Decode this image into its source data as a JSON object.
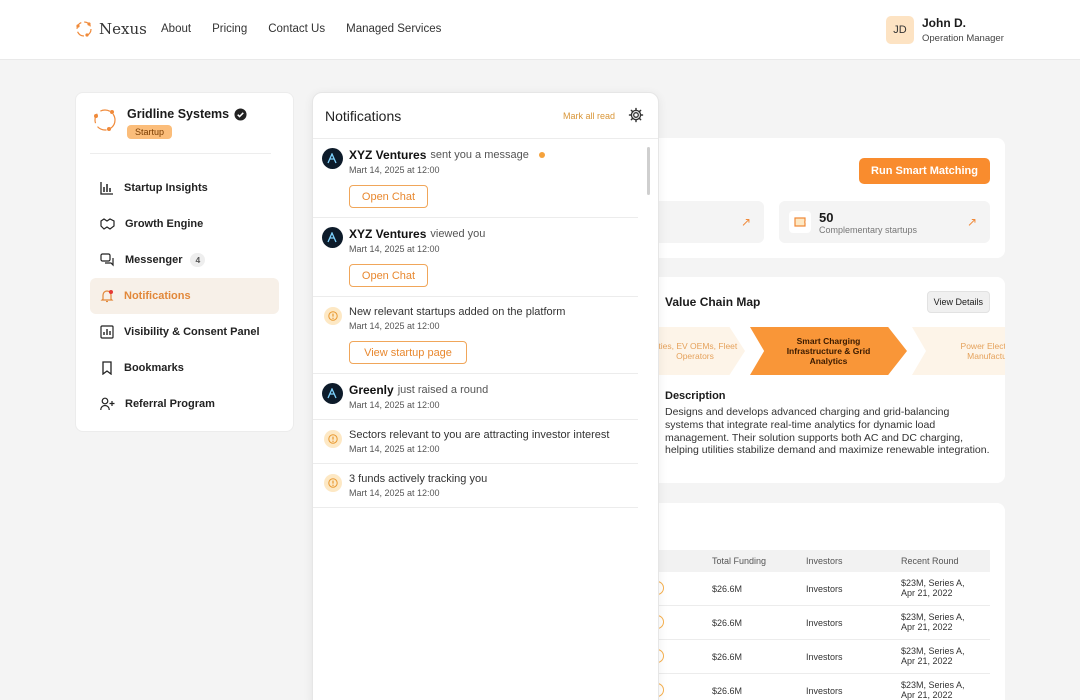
{
  "brand": {
    "name": "Nexus"
  },
  "nav": [
    "About",
    "Pricing",
    "Contact Us",
    "Managed Services"
  ],
  "user": {
    "initials": "JD",
    "name": "John D.",
    "role": "Operation Manager"
  },
  "company": {
    "name": "Gridline Systems",
    "badge": "Startup"
  },
  "menu": [
    {
      "label": "Startup Insights"
    },
    {
      "label": "Growth Engine"
    },
    {
      "label": "Messenger",
      "count": "4"
    },
    {
      "label": "Notifications"
    },
    {
      "label": "Visibility & Consent Panel"
    },
    {
      "label": "Bookmarks"
    },
    {
      "label": "Referral Program"
    }
  ],
  "matching": {
    "button": "Run Smart Matching",
    "stat": {
      "value": "50",
      "label": "Complementary startups"
    }
  },
  "value_chain": {
    "title": "Value Chain Map",
    "view_details": "View Details",
    "steps": [
      "ilities, EV OEMs, Fleet Operators",
      "Smart Charging Infrastructure & Grid Analytics",
      "Power Electro Manufactu"
    ],
    "description_title": "Description",
    "description": "Designs and develops advanced charging and grid-balancing systems that integrate real-time analytics for dynamic load management. Their solution supports both AC and DC charging, helping utilities stabilize demand and maximize renewable integration."
  },
  "table": {
    "headers": [
      "Total Funding",
      "Investors",
      "Recent Round"
    ],
    "rows": [
      {
        "funding": "$26.6M",
        "investors": "Investors",
        "round": "$23M, Series A, Apr 21, 2022"
      },
      {
        "funding": "$26.6M",
        "investors": "Investors",
        "round": "$23M, Series A, Apr 21, 2022"
      },
      {
        "funding": "$26.6M",
        "investors": "Investors",
        "round": "$23M, Series A, Apr 21, 2022"
      },
      {
        "funding": "$26.6M",
        "investors": "Investors",
        "round": "$23M, Series A, Apr 21, 2022"
      }
    ]
  },
  "notifications": {
    "title": "Notifications",
    "mark_all": "Mark all read",
    "items": [
      {
        "actor": "XYZ Ventures",
        "text": "sent you a message",
        "date": "Mart 14, 2025 at 12:00",
        "button": "Open Chat"
      },
      {
        "actor": "XYZ Ventures",
        "text": "viewed you",
        "date": "Mart 14, 2025 at 12:00",
        "button": "Open Chat"
      },
      {
        "text": "New relevant startups added on the platform",
        "date": "Mart 14, 2025 at 12:00",
        "button": "View startup page"
      },
      {
        "actor": "Greenly",
        "text": "just raised a round",
        "date": "Mart 14, 2025 at 12:00"
      },
      {
        "text": "Sectors relevant to you are attracting investor interest",
        "date": "Mart 14, 2025 at 12:00"
      },
      {
        "text": "3 funds actively tracking you",
        "date": "Mart 14, 2025 at 12:00"
      }
    ]
  }
}
